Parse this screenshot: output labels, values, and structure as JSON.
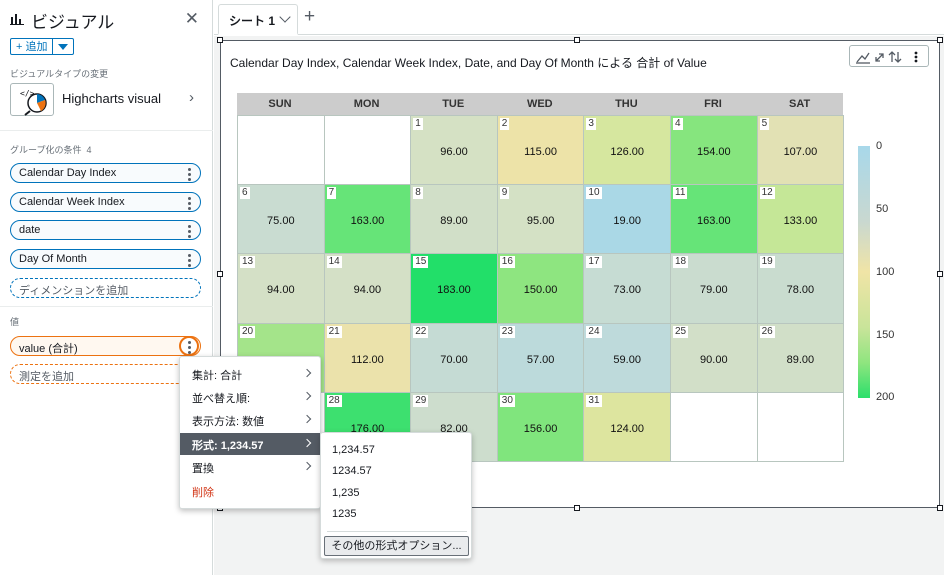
{
  "left_panel": {
    "title": "ビジュアル",
    "add_button": "+ 追加",
    "visual_type_label": "ビジュアルタイプの変更",
    "visual_type_name": "Highcharts visual",
    "group_by_label": "グループ化の条件",
    "group_by_count": "4",
    "group_by_fields": [
      "Calendar Day Index",
      "Calendar Week Index",
      "date",
      "Day Of Month"
    ],
    "add_dimension": "ディメンションを追加",
    "values_label": "値",
    "value_field": "value (合計)",
    "add_measure": "測定を追加"
  },
  "tabs": {
    "sheet_label": "シート 1"
  },
  "visual": {
    "title": "Calendar Day Index, Calendar Week Index, Date, and Day Of Month による 合計 of Value"
  },
  "calendar": {
    "weekdays": [
      "SUN",
      "MON",
      "TUE",
      "WED",
      "THU",
      "FRI",
      "SAT"
    ],
    "weeks": [
      [
        null,
        null,
        {
          "day": "1",
          "value": "96.00",
          "color": "#d5e1c4"
        },
        {
          "day": "2",
          "value": "115.00",
          "color": "#ede3a8"
        },
        {
          "day": "3",
          "value": "126.00",
          "color": "#d6e79f"
        },
        {
          "day": "4",
          "value": "154.00",
          "color": "#86e57e"
        },
        {
          "day": "5",
          "value": "107.00",
          "color": "#e2e1b4"
        }
      ],
      [
        {
          "day": "6",
          "value": "75.00",
          "color": "#c9dcd1"
        },
        {
          "day": "7",
          "value": "163.00",
          "color": "#66e478"
        },
        {
          "day": "8",
          "value": "89.00",
          "color": "#d1dfc8"
        },
        {
          "day": "9",
          "value": "95.00",
          "color": "#d4e1c5"
        },
        {
          "day": "10",
          "value": "19.00",
          "color": "#aad8e6"
        },
        {
          "day": "11",
          "value": "163.00",
          "color": "#66e478"
        },
        {
          "day": "12",
          "value": "133.00",
          "color": "#c5e797"
        }
      ],
      [
        {
          "day": "13",
          "value": "94.00",
          "color": "#d4e0c6"
        },
        {
          "day": "14",
          "value": "94.00",
          "color": "#d4e0c6"
        },
        {
          "day": "15",
          "value": "183.00",
          "color": "#22df69"
        },
        {
          "day": "16",
          "value": "150.00",
          "color": "#8ee580"
        },
        {
          "day": "17",
          "value": "73.00",
          "color": "#c6dcd3"
        },
        {
          "day": "18",
          "value": "79.00",
          "color": "#cadccf"
        },
        {
          "day": "19",
          "value": "78.00",
          "color": "#c9dccf"
        }
      ],
      [
        {
          "day": "20",
          "value": "",
          "color": "#a4e48a"
        },
        {
          "day": "21",
          "value": "112.00",
          "color": "#ebe2ab"
        },
        {
          "day": "22",
          "value": "70.00",
          "color": "#c5dbd4"
        },
        {
          "day": "23",
          "value": "57.00",
          "color": "#bcdadb"
        },
        {
          "day": "24",
          "value": "59.00",
          "color": "#bedadb"
        },
        {
          "day": "25",
          "value": "90.00",
          "color": "#d2dfc8"
        },
        {
          "day": "26",
          "value": "89.00",
          "color": "#d1dfc8"
        }
      ],
      [
        {
          "day": "",
          "value": "",
          "color": "#ffffff"
        },
        {
          "day": "28",
          "value": "176.00",
          "color": "#3de06f"
        },
        {
          "day": "29",
          "value": "82.00",
          "color": "#cdddcd"
        },
        {
          "day": "30",
          "value": "156.00",
          "color": "#80e57d"
        },
        {
          "day": "31",
          "value": "124.00",
          "color": "#dde59f"
        },
        null,
        null
      ]
    ],
    "legend_ticks": [
      "0",
      "50",
      "100",
      "150",
      "200"
    ]
  },
  "context_menu": {
    "items": [
      "集計: 合計",
      "並べ替え順:",
      "表示方法: 数値",
      "形式: 1,234.57",
      "置換",
      "削除"
    ]
  },
  "format_submenu": {
    "options": [
      "1,234.57",
      "1234.57",
      "1,235",
      "1235"
    ],
    "more_button": "その他の形式オプション..."
  }
}
